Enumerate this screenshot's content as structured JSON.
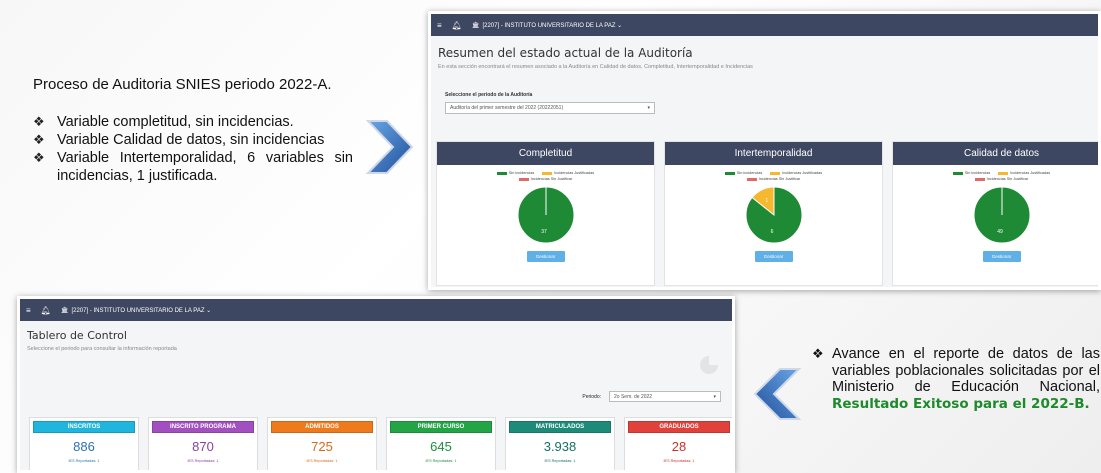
{
  "left": {
    "intro": "Proceso de Auditoria SNIES periodo 2022-A.",
    "bullets": [
      "Variable completitud, sin incidencias.",
      "Variable Calidad de datos, sin incidencias",
      "Variable Intertemporalidad, 6 variables sin incidencias, 1 justificada."
    ],
    "bullet_icon": "diamond-bullet-icon"
  },
  "right": {
    "text": "Avance en el reporte de datos de las variables poblacionales solicitadas por el Ministerio de Educación Nacional, ",
    "highlight": "Resultado Exitoso para el 2022-B."
  },
  "shot1": {
    "institution": "[2207] - INSTITUTO UNIVERSITARIO DE LA PAZ ⌄",
    "title": "Resumen del estado actual de la Auditoría",
    "subtitle": "En esta sección encontrará el resumen asociado a la Auditoría en Calidad de datos, Completitud, Intertemporalidad e Incidencias",
    "select_label": "Seleccione el periodo de la Auditoría",
    "select_value": "Auditoría del primer semestre del 2022 (20222051)",
    "legend": [
      "Sin incidencias",
      "Incidencias Justificadas",
      "Incidencias Sin Justificar"
    ],
    "button": "Gestionar",
    "cards": [
      {
        "title": "Completitud",
        "sin": 37,
        "justificadas": 0,
        "label": "37"
      },
      {
        "title": "Intertemporalidad",
        "sin": 6,
        "justificadas": 1,
        "label": "6",
        "label_j": "1"
      },
      {
        "title": "Calidad de datos",
        "sin": 49,
        "justificadas": 0,
        "label": "49"
      }
    ],
    "colors": {
      "green": "#1f8a35",
      "yellow": "#f5b82e",
      "red": "#e06a6a",
      "navy": "#3e4761"
    }
  },
  "shot2": {
    "institution": "[2207] - INSTITUTO UNIVERSITARIO DE LA PAZ ⌄",
    "title": "Tablero de Control",
    "subtitle": "Seleccione el periodo para consultar la información reportada",
    "period_label": "Periodo:",
    "period_value": "2o Sem. de 2022",
    "kpis": [
      {
        "label": "INSCRITOS",
        "value": "886",
        "sub": "IES Reportadas: 1",
        "color": "#1fb5dc",
        "text_color": "#2a73b8"
      },
      {
        "label": "INSCRITO PROGRAMA",
        "value": "870",
        "sub": "IES Reportadas: 1",
        "color": "#a24fbf",
        "text_color": "#8a3fa3"
      },
      {
        "label": "ADMITIDOS",
        "value": "725",
        "sub": "IES Reportadas: 1",
        "color": "#ee7a1e",
        "text_color": "#d8691a"
      },
      {
        "label": "PRIMER CURSO",
        "value": "645",
        "sub": "IES Reportadas: 1",
        "color": "#22a447",
        "text_color": "#1e8d3d"
      },
      {
        "label": "MATRICULADOS",
        "value": "3.938",
        "sub": "IES Reportadas: 1",
        "color": "#1d8a7a",
        "text_color": "#176f63"
      },
      {
        "label": "GRADUADOS",
        "value": "28",
        "sub": "IES Reportadas: 1",
        "color": "#e0413a",
        "text_color": "#c8322c"
      }
    ]
  },
  "icons": [
    "hamburger-menu-icon",
    "bell-icon",
    "institution-icon",
    "pie-chart-icon",
    "chevron-right-icon",
    "chevron-left-icon"
  ]
}
